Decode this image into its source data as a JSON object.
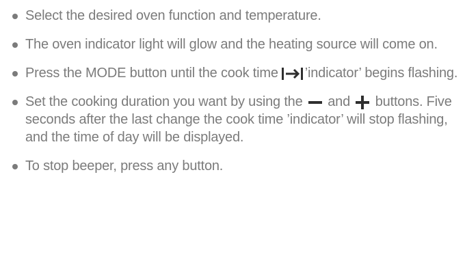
{
  "steps": [
    {
      "text": "Select the desired oven function and temperature."
    },
    {
      "text": "The oven indicator light will glow and the heating source will come on."
    },
    {
      "before": "Press the MODE button until the cook time",
      "after": "’indicator’ begins flashing."
    },
    {
      "before": "Set the cooking duration you want by using the",
      "middle": "and",
      "after": "buttons. Five seconds after the last change the cook time ’indicator’ will stop flashing, and the time of day will be displayed."
    },
    {
      "text": "To stop beeper, press any button."
    }
  ],
  "icons": {
    "cook_time": "cook-time-arrow-bar-icon",
    "minus": "minus-icon",
    "plus": "plus-icon"
  },
  "colors": {
    "text": "#7b7b7b",
    "icon": "#2f2f2f"
  }
}
